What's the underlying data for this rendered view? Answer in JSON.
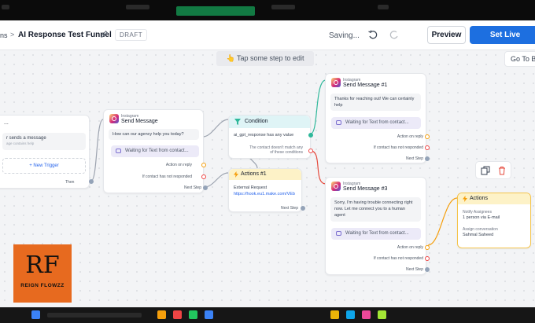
{
  "header": {
    "breadcrumb_prev": "ns",
    "breadcrumb_sep": ">",
    "funnel_title": "AI Response Test Funnel",
    "draft_label": "DRAFT",
    "saving_text": "Saving...",
    "preview_label": "Preview",
    "set_live_label": "Set Live"
  },
  "canvas": {
    "hint": "👆 Tap some step to edit",
    "goto_label": "Go To B"
  },
  "trigger": {
    "title": "...",
    "message_line": "r sends a message",
    "sub_line": "age contains help",
    "new_trigger_label": "+ New Trigger",
    "then_label": "Then"
  },
  "send1": {
    "platform": "Instagram",
    "title": "Send Message",
    "bubble": "How can our agency help you today?",
    "waiting": "Waiting for Text from contact...",
    "action_on_reply": "Action on reply",
    "not_responded": "If contact has not responded",
    "next_step": "Next Step"
  },
  "condition": {
    "title": "Condition",
    "rule": "ai_gpt_response has any value",
    "else_line1": "The contact doesn't match any",
    "else_line2": "of these conditions"
  },
  "actions1": {
    "title": "Actions #1",
    "label": "External Request",
    "url": "https://hook.eu1.make.com/VEb",
    "next_step": "Next Step"
  },
  "send3": {
    "platform": "Instagram",
    "title": "Send Message #1",
    "bubble_l1": "Thanks for reaching out! We can certainly",
    "bubble_l2": "help",
    "waiting": "Waiting for Text from contact...",
    "action_on_reply": "Action on reply",
    "not_responded": "If contact has not responded",
    "next_step": "Next Step"
  },
  "send4": {
    "platform": "Instagram",
    "title": "Send Message #3",
    "bubble_l1": "Sorry, I'm having trouble connecting right",
    "bubble_l2": "now. Let me connect you to a human",
    "bubble_l3": "agent",
    "waiting": "Waiting for Text from contact...",
    "action_on_reply": "Action on reply",
    "not_responded": "If contact has not responded",
    "next_step": "Next Step"
  },
  "actions2": {
    "title": "Actions",
    "notify_label": "Notify Assignees",
    "notify_value": "1 person via E-mail",
    "assign_label": "Assign conversation",
    "assign_value": "Sahmal Saheed"
  },
  "logo": {
    "mark": "RF",
    "text": "REIGN FLOWZZ"
  },
  "colors": {
    "primary": "#1d6fe0",
    "condition": "#dff4f6",
    "actions": "#fdf2c7",
    "logo_bg": "#e76a1f",
    "wire_green": "#2fb89a",
    "wire_red": "#e5483b"
  }
}
